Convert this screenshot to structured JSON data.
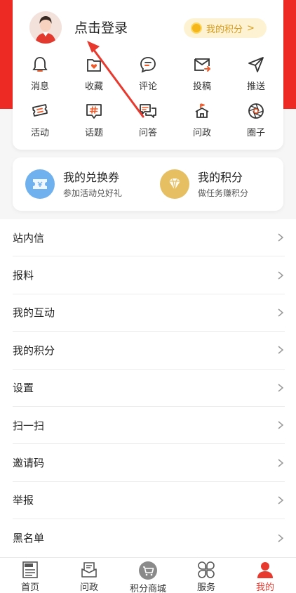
{
  "profile": {
    "login_text": "点击登录",
    "points_chip_label": "我的积分",
    "points_chip_arrow": ">"
  },
  "shortcuts": [
    {
      "label": "消息",
      "icon": "bell-icon"
    },
    {
      "label": "收藏",
      "icon": "favorite-folder-icon"
    },
    {
      "label": "评论",
      "icon": "comment-bubble-icon"
    },
    {
      "label": "投稿",
      "icon": "mail-submit-icon"
    },
    {
      "label": "推送",
      "icon": "send-arrow-icon"
    },
    {
      "label": "活动",
      "icon": "ticket-icon"
    },
    {
      "label": "话题",
      "icon": "hashtag-icon"
    },
    {
      "label": "问答",
      "icon": "qa-chat-icon"
    },
    {
      "label": "问政",
      "icon": "government-building-icon"
    },
    {
      "label": "圈子",
      "icon": "aperture-icon"
    }
  ],
  "rewards": {
    "coupon": {
      "title": "我的兑换券",
      "subtitle": "参加活动兑好礼",
      "icon": "coupon-icon",
      "color": "#6fb0ee"
    },
    "points": {
      "title": "我的积分",
      "subtitle": "做任务赚积分",
      "icon": "diamond-icon",
      "color": "#e6bf62"
    }
  },
  "menu": [
    {
      "label": "站内信"
    },
    {
      "label": "报料"
    },
    {
      "label": "我的互动"
    },
    {
      "label": "我的积分"
    },
    {
      "label": "设置"
    },
    {
      "label": "扫一扫"
    },
    {
      "label": "邀请码"
    },
    {
      "label": "举报"
    },
    {
      "label": "黑名单"
    }
  ],
  "tabbar": [
    {
      "label": "首页",
      "icon": "news-home-icon"
    },
    {
      "label": "问政",
      "icon": "inbox-icon"
    },
    {
      "label": "积分商城",
      "icon": "cart-icon"
    },
    {
      "label": "服务",
      "icon": "clover-grid-icon"
    },
    {
      "label": "我的",
      "icon": "user-icon",
      "active": true
    }
  ],
  "colors": {
    "brand_red": "#ee2a24",
    "active_tab": "#e8392e",
    "points_gold": "#d79a1a",
    "icon_stroke": "#333333",
    "icon_accent": "#f05a2a"
  }
}
